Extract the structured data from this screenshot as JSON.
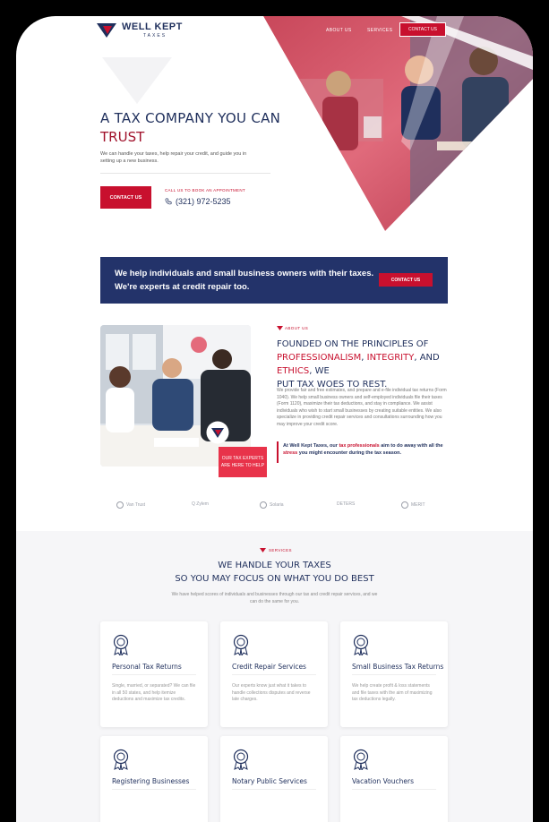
{
  "brand": {
    "name": "WELL KEPT",
    "sub": "TAXES"
  },
  "nav": {
    "about": "ABOUT US",
    "services": "SERVICES",
    "contact": "CONTACT US"
  },
  "hero": {
    "title_line1": "A TAX COMPANY YOU CAN",
    "title_line2": "TRUST",
    "description": "We can handle your taxes, help repair your credit, and guide you in setting up a new business.",
    "button": "CONTACT US",
    "call_label": "CALL US TO BOOK AN APPOINTMENT",
    "phone": "(321) 972-5235"
  },
  "banner": {
    "text": "We help individuals and small business owners with their taxes. We're experts at credit repair too.",
    "button": "CONTACT US"
  },
  "about": {
    "label": "ABOUT US",
    "heading_a": "FOUNDED ON THE PRINCIPLES OF",
    "heading_b1": "PROFESSIONALISM",
    "heading_b2": ", ",
    "heading_b3": "INTEGRITY",
    "heading_b4": ", AND ",
    "heading_b5": "ETHICS",
    "heading_b6": ", WE",
    "heading_c": "PUT TAX WOES TO REST.",
    "paragraph": "We provide fair and free estimates, and prepare and e-file individual tax returns (Form 1040). We help small business owners and self-employed individuals file their taxes (Form 1120), maximize their tax deductions, and stay in compliance. We assist individuals who wish to start small businesses by creating suitable entities. We also specialize in providing credit repair services and consultations surrounding how you may improve your credit score.",
    "quote_a": "At Well Kept Taxes, our ",
    "quote_b": "tax professionals",
    "quote_c": " aim to do away with all the ",
    "quote_d": "stress",
    "quote_e": " you might encounter during the tax season.",
    "badge": "OUR TAX EXPERTS ARE HERE TO HELP"
  },
  "brands": [
    "Van Trust",
    "Q Zylem",
    "Solaria",
    "DETERS",
    "MERIT"
  ],
  "services": {
    "label": "SERVICES",
    "title_line1": "WE HANDLE YOUR TAXES",
    "title_line2": "SO YOU MAY FOCUS ON WHAT YOU DO BEST",
    "subtitle": "We have helped scores of individuals and businesses through our tax and credit repair services, and we can do the same for you.",
    "cards": [
      {
        "title": "Personal Tax Returns",
        "text": "Single, married, or separated? We can file in all 50 states, and help itemize deductions and maximize tax credits."
      },
      {
        "title": "Credit Repair Services",
        "text": "Our experts know just what it takes to handle collections disputes and reverse late charges."
      },
      {
        "title": "Small Business Tax Returns",
        "text": "We help create profit & loss statements and file taxes with the aim of maximizing tax deductions legally."
      },
      {
        "title": "Registering Businesses",
        "text": ""
      },
      {
        "title": "Notary Public Services",
        "text": ""
      },
      {
        "title": "Vacation Vouchers",
        "text": ""
      }
    ]
  },
  "colors": {
    "navy": "#1f2f5c",
    "red": "#c8102e",
    "banner": "#23336a"
  }
}
